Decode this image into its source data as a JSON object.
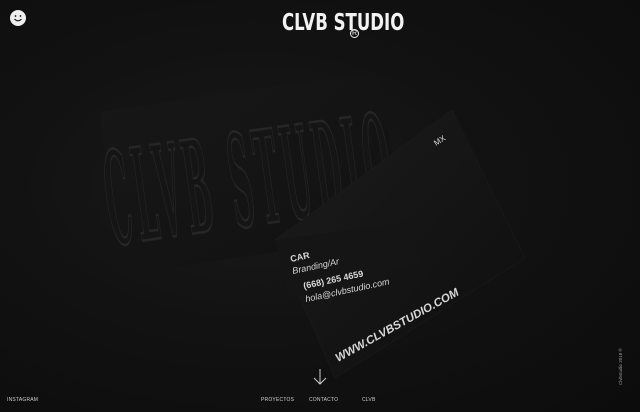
{
  "brand": {
    "logo_text": "CLVB STUDIO",
    "registered_mark": "R"
  },
  "header": {
    "smiley_icon": "smiley-icon"
  },
  "hero": {
    "embossed_text": "CLVB STUDIO",
    "card_back": {
      "country": "MX",
      "website": "WWW.CLVBSTUDIO.COM"
    },
    "card_front": {
      "name_fragment": "CAR",
      "role_fragment": "Branding/Ar",
      "phone": "(668) 265 4659",
      "email": "hola@clvbstudio.com"
    }
  },
  "footer": {
    "instagram": "INSTAGRAM",
    "proyectos": "PROYECTOS",
    "contacto": "CONTACTO",
    "clvb": "CLVB",
    "scroll_icon": "arrow-down-icon",
    "side_text": "Clvbstudio 2018 ®"
  },
  "colors": {
    "background": "#111111",
    "text": "#e8e8e8"
  }
}
